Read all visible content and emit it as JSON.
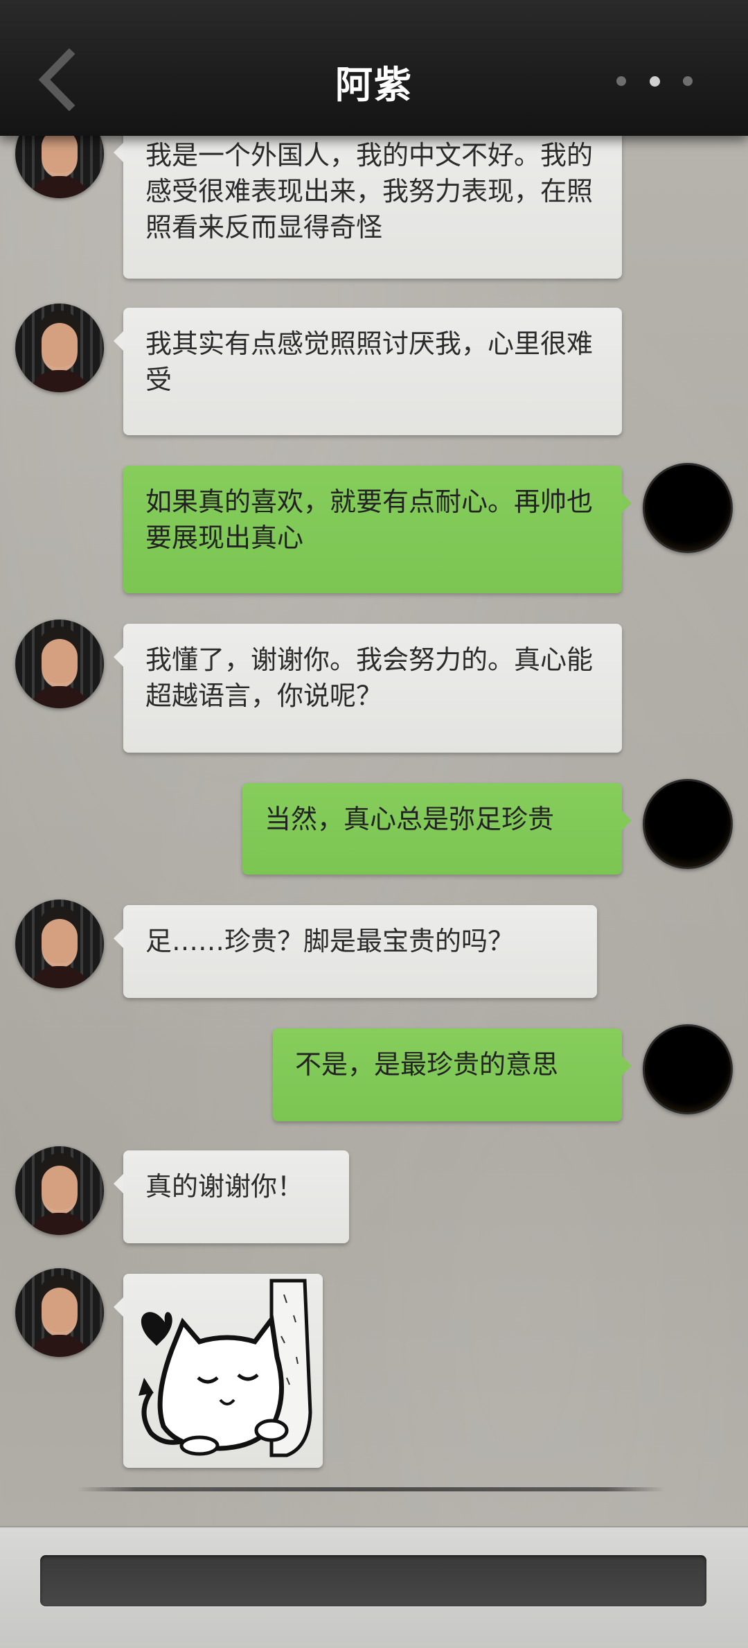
{
  "header": {
    "title": "阿紫",
    "back_icon": "chevron-left-icon",
    "more_icon": "more-dots-icon"
  },
  "messages": [
    {
      "sender": "other",
      "text": "我是一个外国人，我的中文不好。我的感受很难表现出来，我努力表现，在照照看来反而显得奇怪"
    },
    {
      "sender": "other",
      "text": "我其实有点感觉照照讨厌我，心里很难受"
    },
    {
      "sender": "self",
      "text": "如果真的喜欢，就要有点耐心。再帅也要展现出真心"
    },
    {
      "sender": "other",
      "text": "我懂了，谢谢你。我会努力的。真心能超越语言，你说呢？"
    },
    {
      "sender": "self",
      "text": "当然，真心总是弥足珍贵"
    },
    {
      "sender": "other",
      "text": "足……珍贵？脚是最宝贵的吗？"
    },
    {
      "sender": "self",
      "text": "不是，是最珍贵的意思"
    },
    {
      "sender": "other",
      "text": "真的谢谢你！"
    },
    {
      "sender": "other",
      "type": "sticker",
      "sticker": "cat-hugging-leg-sticker"
    }
  ],
  "input": {
    "placeholder": ""
  },
  "colors": {
    "self_bubble": "#7cc553",
    "other_bubble": "#e6e6e3",
    "header": "#1c1c1c"
  }
}
